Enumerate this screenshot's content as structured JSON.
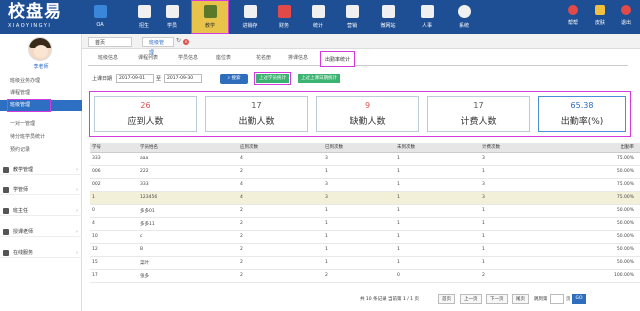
{
  "logo": {
    "name": "校盘易",
    "subtitle": "XIAOYINGYI"
  },
  "nav": [
    {
      "label": "OA",
      "icon": "oa-icon",
      "color": "#3a86d8"
    },
    {
      "label": "招生",
      "icon": "enroll-icon",
      "color": "#f0f0f0"
    },
    {
      "label": "学员",
      "icon": "student-icon",
      "color": "#f0f0f0"
    },
    {
      "label": "教学",
      "icon": "teaching-icon",
      "color": "#5a7a2a"
    },
    {
      "label": "进销存",
      "icon": "inventory-icon",
      "color": "#f0f0f0"
    },
    {
      "label": "财务",
      "icon": "finance-icon",
      "color": "#e24a4a"
    },
    {
      "label": "统计",
      "icon": "stats-icon",
      "color": "#f0f0f0"
    },
    {
      "label": "营销",
      "icon": "marketing-icon",
      "color": "#f0f0f0"
    },
    {
      "label": "微网站",
      "icon": "microsite-icon",
      "color": "#f0f0f0"
    },
    {
      "label": "人事",
      "icon": "hr-icon",
      "color": "#f0f0f0"
    },
    {
      "label": "系统",
      "icon": "system-icon",
      "color": "#f0f0f0"
    }
  ],
  "top_right": [
    {
      "label": "帮帮",
      "icon": "help-icon"
    },
    {
      "label": "皮肤",
      "icon": "skin-icon"
    },
    {
      "label": "退出",
      "icon": "logout-icon"
    }
  ],
  "sidebar": {
    "teacher_name": "李老师",
    "subitems": [
      "班级业务办理",
      "课程管理",
      "班级管理",
      "一对一管理",
      "待分班学员统计",
      "预约记录"
    ],
    "groups": [
      "教学管理",
      "学管师",
      "班主任",
      "授课老师",
      "在线服务"
    ]
  },
  "page_tabs": {
    "home": "首页",
    "current": "班级管理"
  },
  "subtabs": [
    "班级信息",
    "课程列表",
    "学员信息",
    "座位表",
    "花名册",
    "排课信息",
    "出勤率统计"
  ],
  "filter": {
    "date_label": "上课日期",
    "date_from": "2017-09-01",
    "to_label": "至",
    "date_to": "2017-09-30",
    "search_label": "搜索",
    "btn_stat": "上过学员统计",
    "btn_export": "上过上课日期统计"
  },
  "stats": [
    {
      "value": "26",
      "label": "应到人数",
      "color": "#d9534f"
    },
    {
      "value": "17",
      "label": "出勤人数",
      "color": "#555555"
    },
    {
      "value": "9",
      "label": "缺勤人数",
      "color": "#d9534f"
    },
    {
      "value": "17",
      "label": "计费人数",
      "color": "#555555"
    },
    {
      "value": "65.38",
      "label": "出勤率(%)",
      "color": "#2a6bbf"
    }
  ],
  "table": {
    "headers": [
      "学号",
      "学员姓名",
      "应到次数",
      "已到次数",
      "未到次数",
      "计费次数",
      "出勤率"
    ],
    "rows": [
      [
        "333",
        "aaa",
        "4",
        "3",
        "1",
        "3",
        "75.00%"
      ],
      [
        "006",
        "222",
        "2",
        "1",
        "1",
        "1",
        "50.00%"
      ],
      [
        "002",
        "333",
        "4",
        "3",
        "1",
        "3",
        "75.00%"
      ],
      [
        "1",
        "123456",
        "4",
        "3",
        "1",
        "3",
        "75.00%"
      ],
      [
        "0",
        "多多01",
        "2",
        "1",
        "1",
        "1",
        "50.00%"
      ],
      [
        "4",
        "多多11",
        "2",
        "1",
        "1",
        "1",
        "50.00%"
      ],
      [
        "10",
        "c",
        "2",
        "1",
        "1",
        "1",
        "50.00%"
      ],
      [
        "12",
        "B",
        "2",
        "1",
        "1",
        "1",
        "50.00%"
      ],
      [
        "15",
        "菜叶",
        "2",
        "1",
        "1",
        "1",
        "50.00%"
      ],
      [
        "17",
        "张多",
        "2",
        "2",
        "0",
        "2",
        "100.00%"
      ]
    ]
  },
  "pager": {
    "info": "共 10 条记录 当前第 1 / 1 页",
    "first": "首页",
    "prev": "上一页",
    "next": "下一页",
    "last": "尾页",
    "goto": "跳到第",
    "page_unit": "页",
    "go": "GO"
  }
}
